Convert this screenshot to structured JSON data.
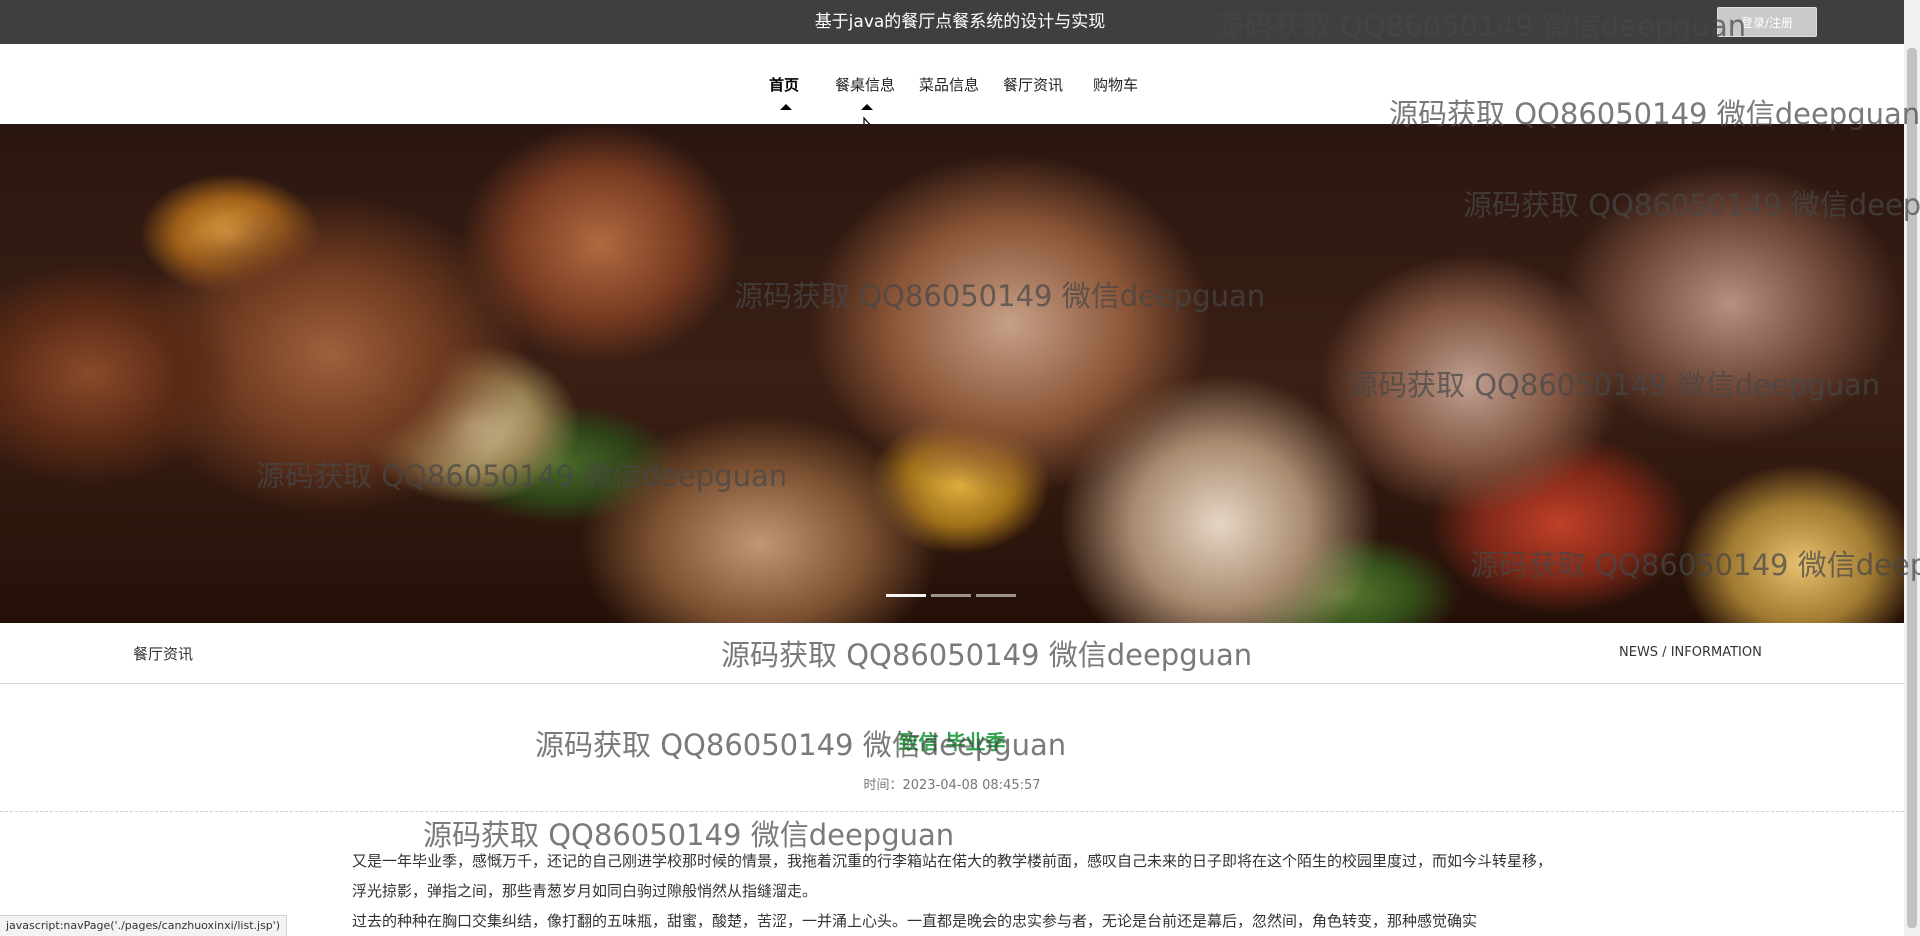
{
  "header": {
    "site_title": "基于java的餐厅点餐系统的设计与实现",
    "login_label": "登录/注册"
  },
  "nav": {
    "items": [
      {
        "label": "首页",
        "active": true
      },
      {
        "label": "餐桌信息"
      },
      {
        "label": "菜品信息"
      },
      {
        "label": "餐厅资讯"
      },
      {
        "label": "购物车"
      }
    ]
  },
  "banner": {
    "slide_count": 3,
    "active_slide": 1
  },
  "section": {
    "title": "餐厅资讯",
    "subtitle": "NEWS / INFORMATION"
  },
  "article": {
    "title": "致信 毕业季",
    "time": "时间：2023-04-08 08:45:57",
    "paragraphs": [
      "又是一年毕业季，感慨万千，还记的自己刚进学校那时候的情景，我拖着沉重的行李箱站在偌大的教学楼前面，感叹自己未来的日子即将在这个陌生的校园里度过，而如今斗转星移，浮光掠影，弹指之间，那些青葱岁月如同白驹过隙般悄然从指缝溜走。",
      "过去的种种在胸口交集纠结，像打翻的五味瓶，甜蜜，酸楚，苦涩，一并涌上心头。一直都是晚会的忠实参与者，无论是台前还是幕后，忽然间，角色转变，那种感觉确实"
    ]
  },
  "watermark_text": "源码获取 QQ86050149 微信deepguan",
  "status_bar": {
    "text": "javascript:navPage('./pages/canzhuoxinxi/list.jsp')"
  },
  "colors": {
    "topbar": "#3f3f3f",
    "article_title": "#2fa24a"
  }
}
